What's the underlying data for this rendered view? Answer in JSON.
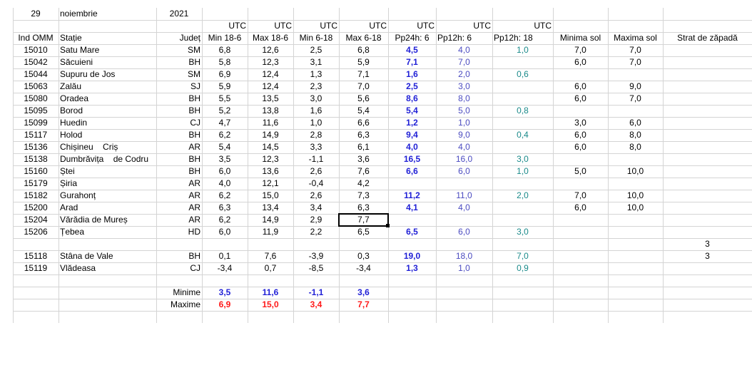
{
  "date": {
    "day": "29",
    "month": "noiembrie",
    "year": "2021"
  },
  "utc_label": "UTC",
  "headers": [
    "Ind OMM",
    "Stație",
    "Județ",
    "Min 18-6",
    "Max 18-6",
    "Min 6-18",
    "Max 6-18",
    "Pp24h: 6",
    "Pp12h: 6",
    "Pp12h: 18",
    "Minima sol",
    "Maxima sol",
    "Strat de zăpadă"
  ],
  "rows": [
    [
      "15010",
      "Satu Mare",
      "SM",
      "6,8",
      "12,6",
      "2,5",
      "6,8",
      "4,5",
      "4,0",
      "1,0",
      "7,0",
      "7,0",
      ""
    ],
    [
      "15042",
      "Săcuieni",
      "BH",
      "5,8",
      "12,3",
      "3,1",
      "5,9",
      "7,1",
      "7,0",
      "",
      "6,0",
      "7,0",
      ""
    ],
    [
      "15044",
      "Supuru de Jos",
      "SM",
      "6,9",
      "12,4",
      "1,3",
      "7,1",
      "1,6",
      "2,0",
      "0,6",
      "",
      "",
      ""
    ],
    [
      "15063",
      "Zalău",
      "SJ",
      "5,9",
      "12,4",
      "2,3",
      "7,0",
      "2,5",
      "3,0",
      "",
      "6,0",
      "9,0",
      ""
    ],
    [
      "15080",
      "Oradea",
      "BH",
      "5,5",
      "13,5",
      "3,0",
      "5,6",
      "8,6",
      "8,0",
      "",
      "6,0",
      "7,0",
      ""
    ],
    [
      "15095",
      "Borod",
      "BH",
      "5,2",
      "13,8",
      "1,6",
      "5,4",
      "5,4",
      "5,0",
      "0,8",
      "",
      "",
      ""
    ],
    [
      "15099",
      "Huedin",
      "CJ",
      "4,7",
      "11,6",
      "1,0",
      "6,6",
      "1,2",
      "1,0",
      "",
      "3,0",
      "6,0",
      ""
    ],
    [
      "15117",
      "Holod",
      "BH",
      "6,2",
      "14,9",
      "2,8",
      "6,3",
      "9,4",
      "9,0",
      "0,4",
      "6,0",
      "8,0",
      ""
    ],
    [
      "15136",
      "Chișineu    Criș",
      "AR",
      "5,4",
      "14,5",
      "3,3",
      "6,1",
      "4,0",
      "4,0",
      "",
      "6,0",
      "8,0",
      ""
    ],
    [
      "15138",
      "Dumbrăvița    de Codru",
      "BH",
      "3,5",
      "12,3",
      "-1,1",
      "3,6",
      "16,5",
      "16,0",
      "3,0",
      "",
      "",
      ""
    ],
    [
      "15160",
      "Ștei",
      "BH",
      "6,0",
      "13,6",
      "2,6",
      "7,6",
      "6,6",
      "6,0",
      "1,0",
      "5,0",
      "10,0",
      ""
    ],
    [
      "15179",
      "Șiria",
      "AR",
      "4,0",
      "12,1",
      "-0,4",
      "4,2",
      "",
      "",
      "",
      "",
      "",
      ""
    ],
    [
      "15182",
      "Gurahonț",
      "AR",
      "6,2",
      "15,0",
      "2,6",
      "7,3",
      "11,2",
      "11,0",
      "2,0",
      "7,0",
      "10,0",
      ""
    ],
    [
      "15200",
      "Arad",
      "AR",
      "6,3",
      "13,4",
      "3,4",
      "6,3",
      "4,1",
      "4,0",
      "",
      "6,0",
      "10,0",
      ""
    ],
    [
      "15204",
      "Vărădia de Mureș",
      "AR",
      "6,2",
      "14,9",
      "2,9",
      "7,7",
      "",
      "",
      "",
      "",
      "",
      ""
    ],
    [
      "15206",
      "Țebea",
      "HD",
      "6,0",
      "11,9",
      "2,2",
      "6,5",
      "6,5",
      "6,0",
      "3,0",
      "",
      "",
      ""
    ],
    [
      "",
      "",
      "",
      "",
      "",
      "",
      "",
      "",
      "",
      "",
      "",
      "",
      "3"
    ],
    [
      "15118",
      "Stâna de Vale",
      "BH",
      "0,1",
      "7,6",
      "-3,9",
      "0,3",
      "19,0",
      "18,0",
      "7,0",
      "",
      "",
      "3"
    ],
    [
      "15119",
      "Vlădeasa",
      "CJ",
      "-3,4",
      "0,7",
      "-8,5",
      "-3,4",
      "1,3",
      "1,0",
      "0,9",
      "",
      "",
      ""
    ]
  ],
  "summary": {
    "min_label": "Minime",
    "max_label": "Maxime",
    "minime": [
      "3,5",
      "11,6",
      "-1,1",
      "3,6"
    ],
    "maxime": [
      "6,9",
      "15,0",
      "3,4",
      "7,7"
    ]
  },
  "colors": {
    "precip_24h": "#1f1fd6",
    "precip_12h_6": "#4b4bc0",
    "precip_12h_18": "#1a8a8a",
    "maxime": "#ff1a1a",
    "gridline": "#d4d4d4"
  },
  "selected_cell": "Max 6-18 / 15204"
}
